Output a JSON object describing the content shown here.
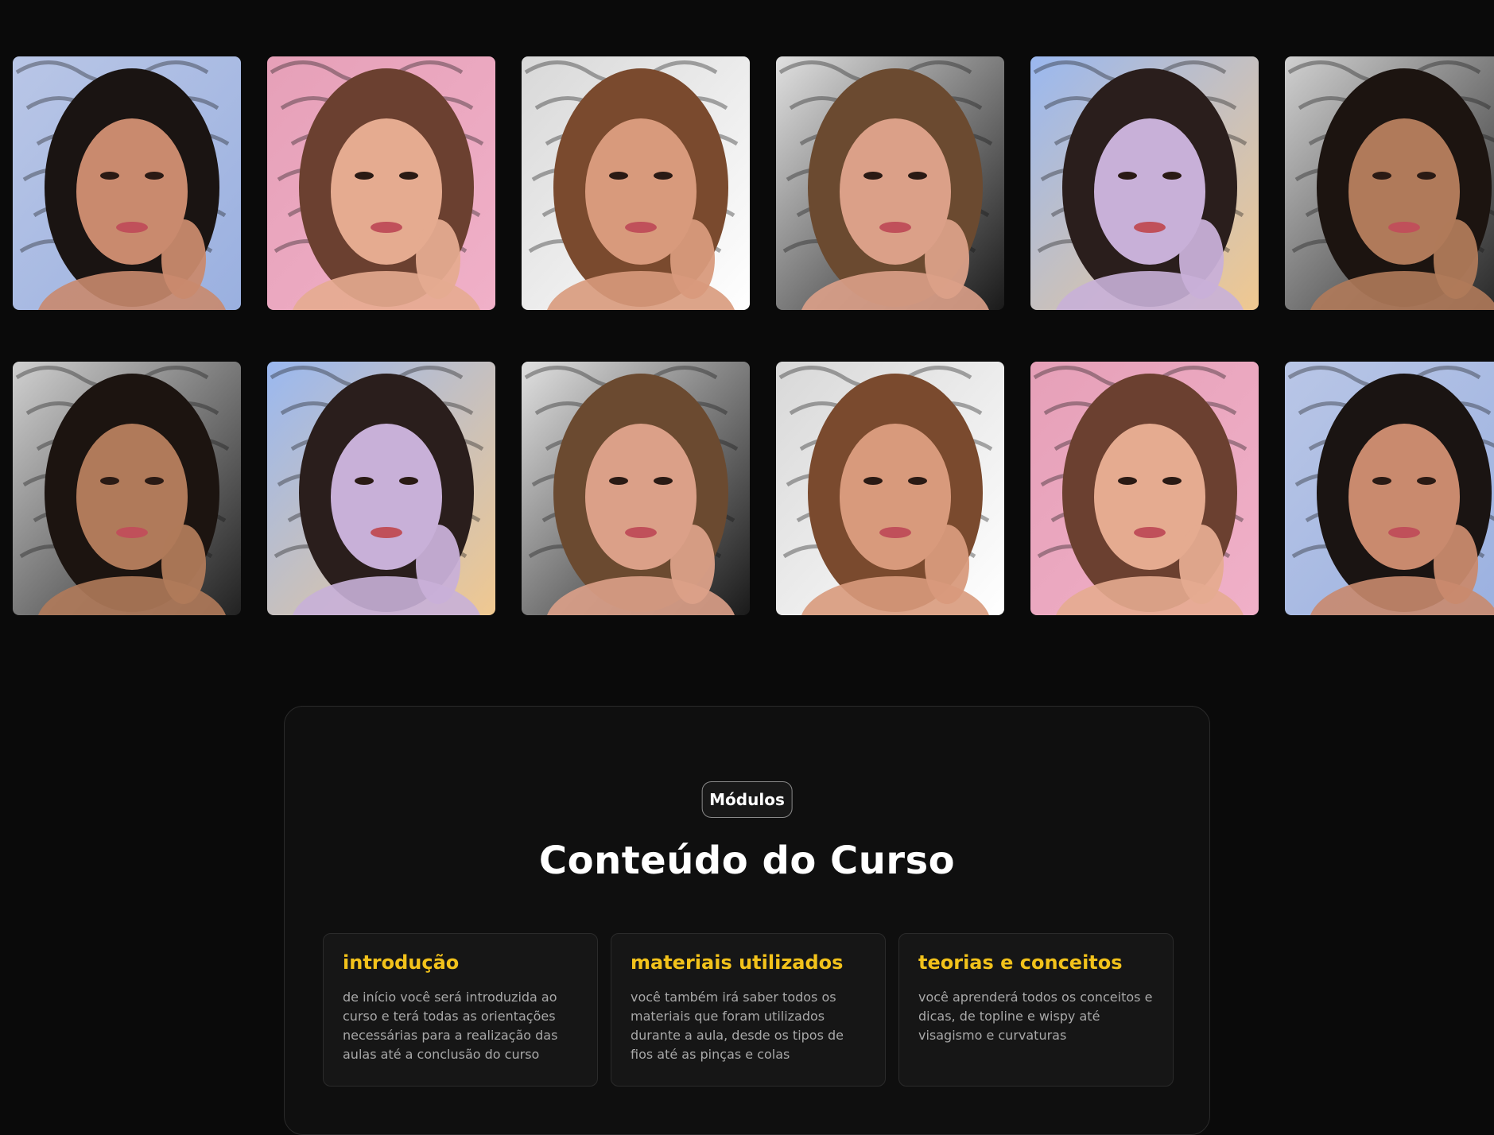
{
  "gallery": {
    "row1": [
      {
        "name": "portrait-1",
        "bg": "#b9c6e6",
        "skin": "#c98a6e",
        "hair": "#1a1412",
        "accent": "#9ab0e0"
      },
      {
        "name": "portrait-2",
        "bg": "#e6a0b8",
        "skin": "#e5ab90",
        "hair": "#6b4030",
        "accent": "#f0b0c8"
      },
      {
        "name": "portrait-3",
        "bg": "#d8d8d8",
        "skin": "#d89a7c",
        "hair": "#7a4a2e",
        "accent": "#ffffff"
      },
      {
        "name": "portrait-4",
        "bg": "#e0e0e0",
        "skin": "#dba088",
        "hair": "#6b4a30",
        "accent": "#1a1a1a"
      },
      {
        "name": "portrait-5",
        "bg": "#9ab8f0",
        "skin": "#c8b0d8",
        "hair": "#2a1e1c",
        "accent": "#f0c890"
      },
      {
        "name": "portrait-6",
        "bg": "#d0d0d0",
        "skin": "#b07a5a",
        "hair": "#1c1410",
        "accent": "#222222"
      }
    ],
    "row2": [
      {
        "name": "portrait-7",
        "bg": "#d0d0d0",
        "skin": "#b07a5a",
        "hair": "#1c1410",
        "accent": "#222222"
      },
      {
        "name": "portrait-8",
        "bg": "#9ab8f0",
        "skin": "#c8b0d8",
        "hair": "#2a1e1c",
        "accent": "#f0c890"
      },
      {
        "name": "portrait-9",
        "bg": "#e0e0e0",
        "skin": "#dba088",
        "hair": "#6b4a30",
        "accent": "#1a1a1a"
      },
      {
        "name": "portrait-10",
        "bg": "#d8d8d8",
        "skin": "#d89a7c",
        "hair": "#7a4a2e",
        "accent": "#ffffff"
      },
      {
        "name": "portrait-11",
        "bg": "#e6a0b8",
        "skin": "#e5ab90",
        "hair": "#6b4030",
        "accent": "#f0b0c8"
      },
      {
        "name": "portrait-12",
        "bg": "#b9c6e6",
        "skin": "#c98a6e",
        "hair": "#1a1412",
        "accent": "#9ab0e0"
      }
    ]
  },
  "modules": {
    "badge": "Módulos",
    "title": "Conteúdo do Curso",
    "accent_color": "#f2c21b",
    "items": [
      {
        "title": "introdução",
        "description": "de início você será introduzida ao curso e terá todas as orientações necessárias para a realização das aulas até a conclusão do curso"
      },
      {
        "title": "materiais utilizados",
        "description": "você também irá saber todos os materiais que foram utilizados durante a aula, desde os tipos de fios até as pinças e colas"
      },
      {
        "title": "teorias e conceitos",
        "description": "você aprenderá todos os conceitos e dicas, de topline e wispy até visagismo e curvaturas"
      }
    ]
  }
}
